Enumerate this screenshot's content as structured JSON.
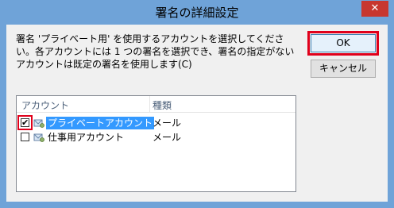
{
  "window": {
    "title": "署名の詳細設定",
    "close_glyph": "✕"
  },
  "description": "署名 'プライベート用' を使用するアカウントを選択してください。各アカウントには 1 つの署名を選択でき、署名の指定がないアカウントは既定の署名を使用します(C)",
  "buttons": {
    "ok": "OK",
    "cancel": "キャンセル"
  },
  "list": {
    "columns": [
      "アカウント",
      "種類"
    ],
    "rows": [
      {
        "account": "プライベートアカウント",
        "type": "メール",
        "checked": true,
        "check_glyph": "✔"
      },
      {
        "account": "仕事用アカウント",
        "type": "メール",
        "checked": false,
        "check_glyph": ""
      }
    ]
  },
  "colors": {
    "highlight": "#e0001b",
    "selection": "#3399ff",
    "close": "#c7372f"
  },
  "icons": {
    "account": "mail-account-icon",
    "check": "checkmark-icon"
  }
}
